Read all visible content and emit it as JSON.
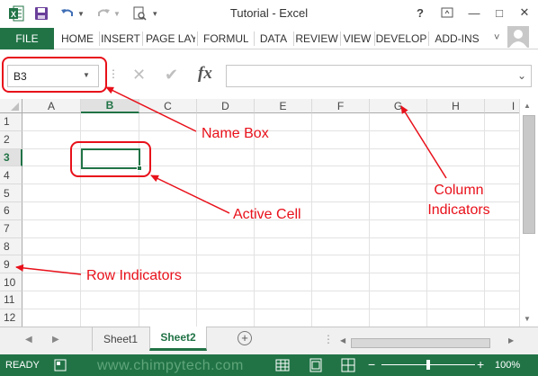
{
  "window": {
    "title": "Tutorial - Excel",
    "help": "?",
    "minimize": "—",
    "restore": "□",
    "close": "✕",
    "ribbon_display": "▫"
  },
  "ribbon": {
    "file_label": "FILE",
    "tabs": [
      "HOME",
      "INSERT",
      "PAGE LAY",
      "FORMUL",
      "DATA",
      "REVIEW",
      "VIEW",
      "DEVELOP",
      "ADD-INS"
    ],
    "collapse_glyph": "˅",
    "accent_color": "#217346"
  },
  "formula_bar": {
    "name_box_value": "B3",
    "cancel_glyph": "✕",
    "enter_glyph": "✔",
    "fx_label": "fx",
    "formula_value": ""
  },
  "grid": {
    "columns": [
      "A",
      "B",
      "C",
      "D",
      "E",
      "F",
      "G",
      "H",
      "I"
    ],
    "rows": [
      "1",
      "2",
      "3",
      "4",
      "5",
      "6",
      "7",
      "8",
      "9",
      "10",
      "11",
      "12"
    ],
    "active_column": "B",
    "active_row": "3",
    "active_cell_value": ""
  },
  "sheets": {
    "tabs": [
      "Sheet1",
      "Sheet2"
    ],
    "active": "Sheet2",
    "add_glyph": "+",
    "more_glyph": "⋮"
  },
  "status": {
    "mode": "READY",
    "watermark": "www.chimpytech.com",
    "zoom": "100%",
    "zoom_minus": "−",
    "zoom_plus": "+"
  },
  "annotations": {
    "name_box": "Name Box",
    "active_cell": "Active Cell",
    "column_indicators_line1": "Column",
    "column_indicators_line2": "Indicators",
    "row_indicators": "Row Indicators",
    "color": "#e8101a"
  }
}
